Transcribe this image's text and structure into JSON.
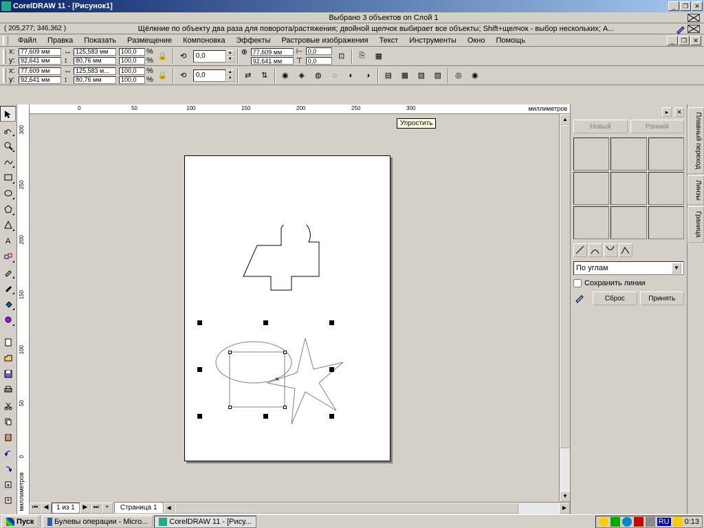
{
  "app": {
    "title": "CorelDRAW 11 - [Рисунок1]"
  },
  "status": {
    "selection_text": "Выбрано 3 объектов on Слой 1",
    "coords": "( 205,277; 346,362 )",
    "hint": "Щёлкние по объекту два раза для поворота/растяжения; двойной щелчок выбирает все объекты; Shift+щелчок - выбор нескольких; A..."
  },
  "menu": {
    "items": [
      "Файл",
      "Правка",
      "Показать",
      "Размещение",
      "Компоновка",
      "Эффекты",
      "Растровые изображения",
      "Текст",
      "Инструменты",
      "Окно",
      "Помощь"
    ]
  },
  "propbar1": {
    "x": "77,609 мм",
    "y": "92,641 мм",
    "w": "125,583 мм",
    "h": "80,76 мм",
    "sx": "100,0",
    "sy": "100,0",
    "rot": "0,0",
    "cx": "77,609 мм",
    "cy": "92,641 мм",
    "ox": "0,0",
    "oy": "0,0"
  },
  "propbar2": {
    "x": "77,609 мм",
    "y": "92,641 мм",
    "w": "125,583 м...",
    "h": "80,76 мм",
    "sx": "100,0",
    "sy": "100,0",
    "rot": "0,0"
  },
  "ruler": {
    "h_labels": [
      {
        "pos": 70,
        "text": "0"
      },
      {
        "pos": 148,
        "text": "50"
      },
      {
        "pos": 228,
        "text": "100"
      },
      {
        "pos": 308,
        "text": "150"
      },
      {
        "pos": 388,
        "text": "200"
      },
      {
        "pos": 468,
        "text": "250"
      },
      {
        "pos": 548,
        "text": "300"
      }
    ],
    "v_labels": [
      {
        "pos": 30,
        "text": "300"
      },
      {
        "pos": 110,
        "text": "250"
      },
      {
        "pos": 190,
        "text": "200"
      },
      {
        "pos": 270,
        "text": "150"
      },
      {
        "pos": 350,
        "text": "100"
      },
      {
        "pos": 430,
        "text": "50"
      },
      {
        "pos": 510,
        "text": "0"
      }
    ],
    "unit": "миллиметров"
  },
  "tooltip": {
    "text": "Упростить"
  },
  "page_nav": {
    "counter": "1 из 1",
    "tab": "Страница 1"
  },
  "docker": {
    "new_btn": "Новый",
    "prev_btn": "Ранний",
    "dropdown": "По углам",
    "checkbox": "Сохранить линии",
    "reset": "Сброс",
    "apply": "Принять"
  },
  "right_tabs": [
    "Плавный переход",
    "Линзы",
    "Граница"
  ],
  "taskbar": {
    "start": "Пуск",
    "task1": "Булевы операции - Micro...",
    "task2": "CorelDRAW 11 - [Рису...",
    "lang": "RU",
    "clock": "0:13"
  }
}
